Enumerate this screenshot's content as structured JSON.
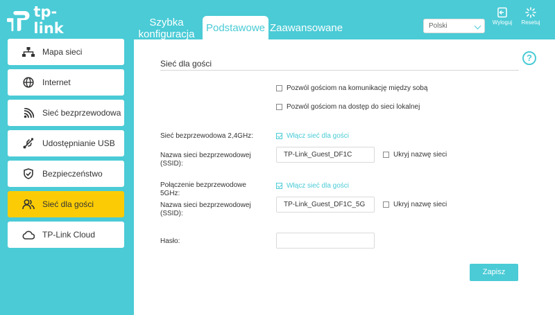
{
  "brand": {
    "name": "tp-link"
  },
  "tabs": {
    "quick": "Szybka konfiguracja",
    "basic": "Podstawowe",
    "advanced": "Zaawansowane"
  },
  "language": {
    "selected": "Polski"
  },
  "header": {
    "logout": "Wyloguj",
    "reset": "Resetuj"
  },
  "sidebar": {
    "items": [
      {
        "label": "Mapa sieci",
        "icon": "network-map-icon"
      },
      {
        "label": "Internet",
        "icon": "globe-icon"
      },
      {
        "label": "Sieć bezprzewodowa",
        "icon": "wifi-icon"
      },
      {
        "label": "Udostępnianie USB",
        "icon": "usb-icon"
      },
      {
        "label": "Bezpieczeństwo",
        "icon": "shield-icon"
      },
      {
        "label": "Sieć dla gości",
        "icon": "guests-icon",
        "active": true
      },
      {
        "label": "TP-Link Cloud",
        "icon": "cloud-icon"
      }
    ]
  },
  "main": {
    "title": "Sieć dla gości",
    "allow_communicate": "Pozwól gościom na komunikację między sobą",
    "allow_local": "Pozwól gościom na dostęp do sieci lokalnej",
    "band24": {
      "label": "Sieć bezprzewodowa 2,4GHz:",
      "enable": "Włącz sieć dla gości",
      "ssid_label": "Nazwa sieci bezprzewodowej (SSID):",
      "ssid_value": "TP-Link_Guest_DF1C",
      "hide": "Ukryj nazwę sieci"
    },
    "band5": {
      "label": "Połączenie bezprzewodowe 5GHz:",
      "enable": "Włącz sieć dla gości",
      "ssid_label": "Nazwa sieci bezprzewodowej (SSID):",
      "ssid_value": "TP-Link_Guest_DF1C_5G",
      "hide": "Ukryj nazwę sieci"
    },
    "password_label": "Hasło:",
    "password_value": "",
    "save": "Zapisz"
  },
  "colors": {
    "accent": "#4acbd6",
    "active": "#fbcc05"
  }
}
